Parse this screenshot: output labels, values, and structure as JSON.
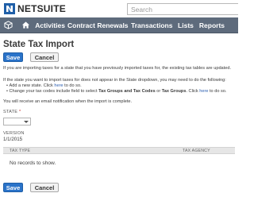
{
  "brand": {
    "name": "NETSUITE"
  },
  "search": {
    "placeholder": "Search"
  },
  "nav": {
    "items": [
      {
        "label": "Activities"
      },
      {
        "label": "Contract Renewals"
      },
      {
        "label": "Transactions"
      },
      {
        "label": "Lists"
      },
      {
        "label": "Reports"
      }
    ]
  },
  "page": {
    "title": "State Tax Import"
  },
  "actions": {
    "save_label": "Save",
    "cancel_label": "Cancel"
  },
  "info": {
    "line1": "If you are importing taxes for a state that you have previously imported taxes for, the existing tax tables are updated.",
    "line2": "If the state you want to import taxes for does not appear in the State dropdown, you may need to do the following:",
    "bullet1_pre": "Add a new state. Click ",
    "bullet1_link": "here",
    "bullet1_post": " to do so.",
    "bullet2_pre": "Change your tax codes include field to select ",
    "bullet2_bold1": "Tax Groups and Tax Codes",
    "bullet2_mid": " or ",
    "bullet2_bold2": "Tax Groups",
    "bullet2_mid2": ". Click ",
    "bullet2_link": "here",
    "bullet2_post": " to do so.",
    "email_note": "You will receive an email notification when the import is complete."
  },
  "form": {
    "state_label": "STATE",
    "state_required_marker": "*",
    "state_value": "",
    "version_label": "VERSION",
    "version_value": "1/1/2015"
  },
  "table": {
    "columns": [
      "TAX TYPE",
      "TAX AGENCY"
    ],
    "empty_message": "No records to show."
  },
  "colors": {
    "nav_bg": "#5e6b7c",
    "primary_button": "#2a73c9",
    "link": "#2a5db0",
    "brand_mark": "#1f5fa8"
  }
}
